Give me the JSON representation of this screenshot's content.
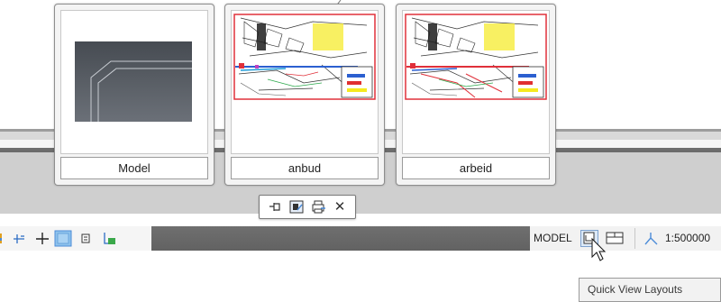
{
  "thumbnails": [
    {
      "label": "Model",
      "kind": "model"
    },
    {
      "label": "anbud",
      "kind": "layout"
    },
    {
      "label": "arbeid",
      "kind": "layout"
    }
  ],
  "mini_toolbar": {
    "icons": [
      "pin-icon",
      "new-layout-icon",
      "publish-icon",
      "close-icon"
    ],
    "close_glyph": "✕"
  },
  "status_bar": {
    "model_label": "MODEL",
    "scale_label": "1:500000",
    "left_icons": [
      "polar-icon",
      "osnap-track-icon",
      "ortho-icon",
      "grid-icon",
      "display-icon",
      "ucs-icon"
    ]
  },
  "tooltip": {
    "text": "Quick View Layouts"
  },
  "colors": {
    "statusbar": "#666666",
    "selected": "#dce9f7",
    "accent": "#4c8cd8"
  }
}
